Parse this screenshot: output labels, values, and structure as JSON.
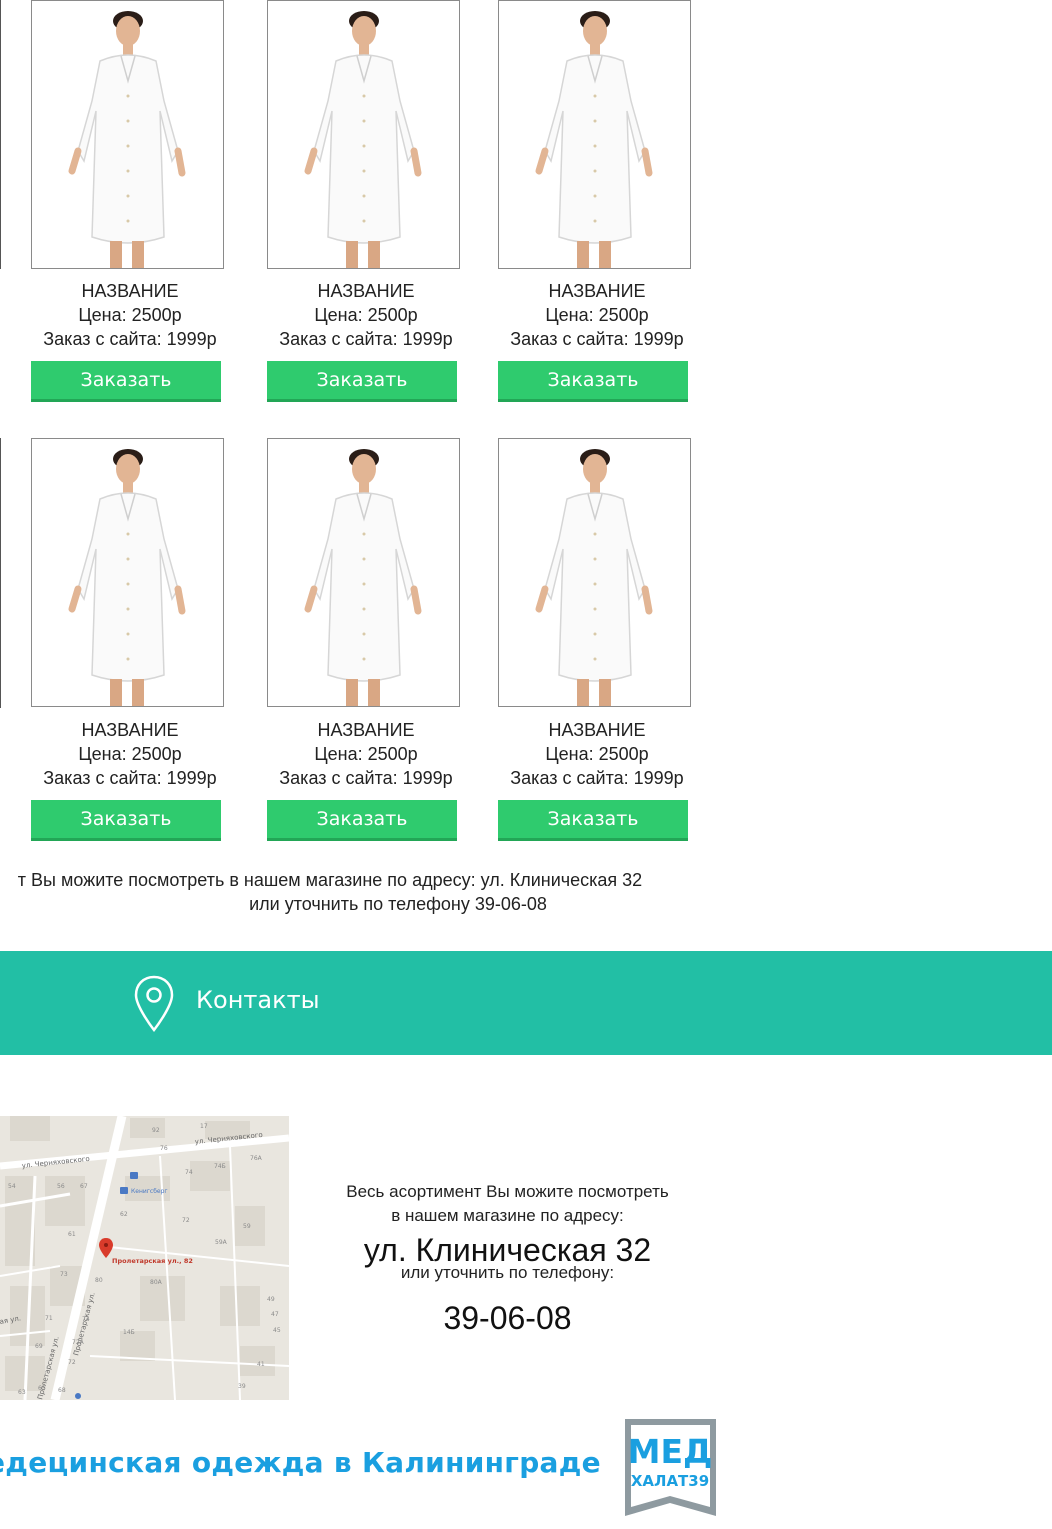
{
  "products": [
    {
      "name": "НАЗВАНИЕ",
      "price": "Цена: 2500р",
      "site_price": "Заказ с сайта: 1999р",
      "button": "Заказать"
    },
    {
      "name": "НАЗВАНИЕ",
      "price": "Цена: 2500р",
      "site_price": "Заказ с сайта: 1999р",
      "button": "Заказать"
    },
    {
      "name": "НАЗВАНИЕ",
      "price": "Цена: 2500р",
      "site_price": "Заказ с сайта: 1999р",
      "button": "Заказать"
    },
    {
      "name": "НАЗВАНИЕ",
      "price": "Цена: 2500р",
      "site_price": "Заказ с сайта: 1999р",
      "button": "Заказать"
    },
    {
      "name": "НАЗВАНИЕ",
      "price": "Цена: 2500р",
      "site_price": "Заказ с сайта: 1999р",
      "button": "Заказать"
    },
    {
      "name": "НАЗВАНИЕ",
      "price": "Цена: 2500р",
      "site_price": "Заказ с сайта: 1999р",
      "button": "Заказать"
    }
  ],
  "shop_note": {
    "line1": "т Вы можите посмотреть в нашем магазине по адресу: ул. Клиническая 32",
    "line2": "или уточнить по телефону 39-06-08"
  },
  "contacts": {
    "title": "Контакты",
    "icon": "map-pin-icon",
    "color": "#22bfa5"
  },
  "map": {
    "streets": [
      "ул. Черняховского",
      "ул. Черняховского",
      "Пролетарская ул.",
      "Пролетарская ул.",
      "ая ул."
    ],
    "marker_label": "Пролетарская ул., 82",
    "poi": "Кенигсберг",
    "numbers": [
      "92",
      "17",
      "76",
      "74",
      "74Б",
      "76А",
      "54",
      "56",
      "67",
      "62",
      "72",
      "59",
      "59А",
      "61",
      "80",
      "80А",
      "49",
      "47",
      "45",
      "73",
      "74",
      "14Б",
      "71",
      "69",
      "72А",
      "72",
      "41",
      "39",
      "63",
      "65",
      "68"
    ]
  },
  "info": {
    "line1": "Весь асортимент Вы можите посмотреть",
    "line2": "в нашем магазине по адресу:",
    "address": "ул. Клиническая 32",
    "line3": "или уточнить по телефону:",
    "phone": "39-06-08"
  },
  "footer": {
    "title": "едецинская одежда в Калининграде",
    "logo_top": "МЕД",
    "logo_bottom": "ХАЛАТ39",
    "title_color": "#1a9fe0",
    "logo_blue": "#1a9fe0",
    "logo_orange": "#f7941d"
  }
}
